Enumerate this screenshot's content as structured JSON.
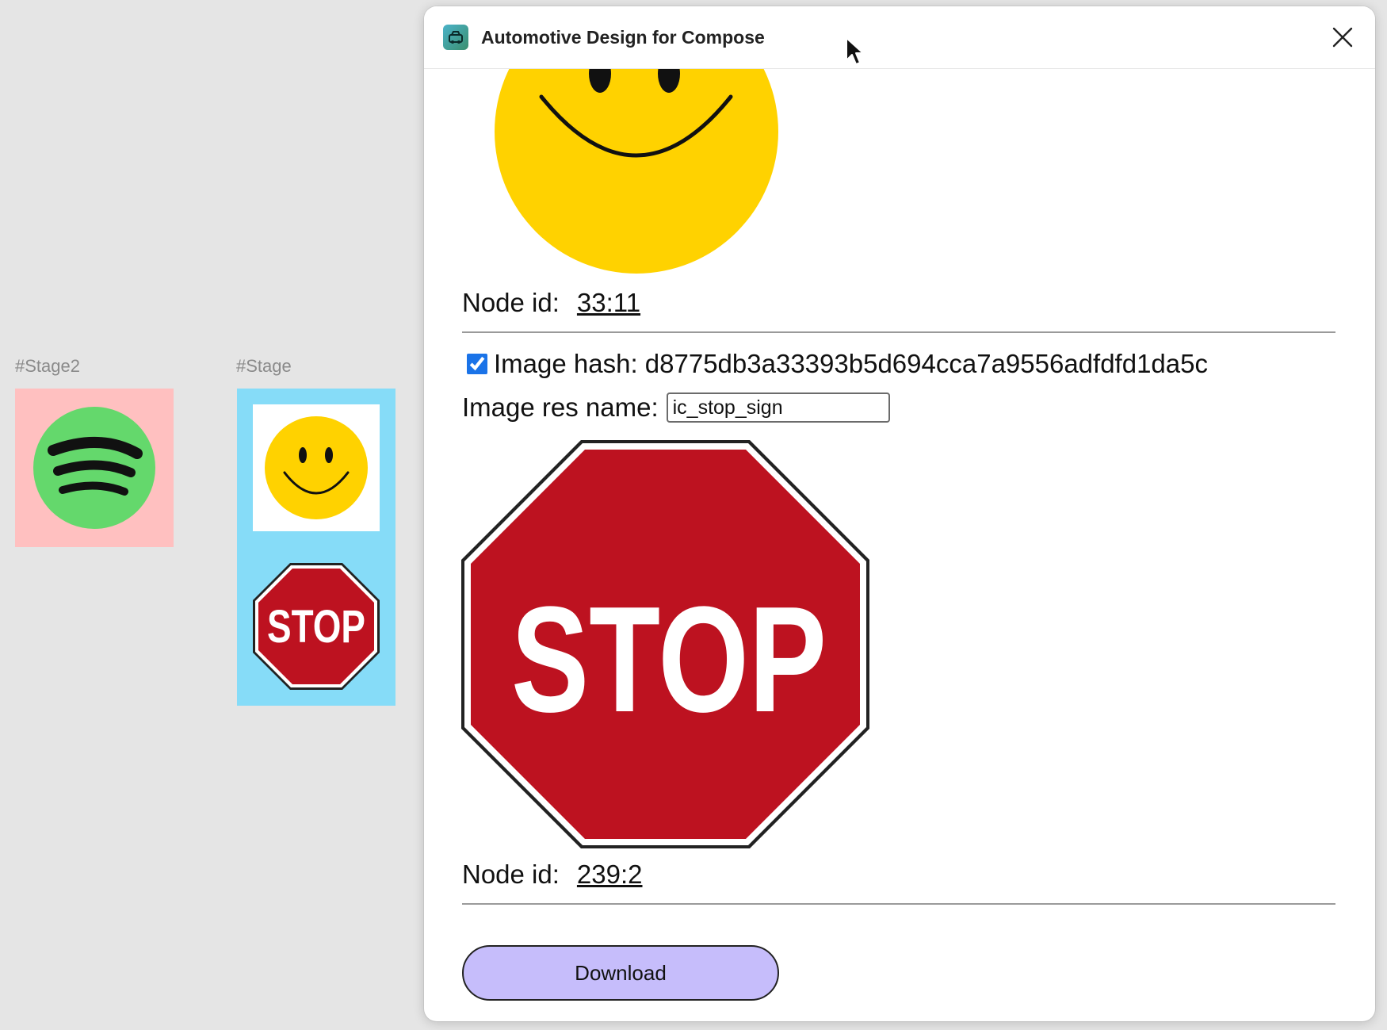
{
  "canvas": {
    "frames": [
      {
        "label": "#Stage2",
        "contents": [
          "spotify-logo"
        ]
      },
      {
        "label": "#Stage",
        "contents": [
          "smiley-face",
          "stop-sign"
        ]
      }
    ]
  },
  "plugin": {
    "title": "Automotive Design for Compose",
    "close_icon": "close-icon",
    "images": [
      {
        "node_id_label": "Node id:",
        "node_id": "33:11"
      },
      {
        "hash_label": "Image hash:",
        "hash_value": "d8775db3a33393b5d694cca7a9556adfdfd1da5c",
        "hash_checked": true,
        "res_name_label": "Image res name:",
        "res_name_value": "ic_stop_sign",
        "image_text": "STOP",
        "node_id_label": "Node id:",
        "node_id": "239:2"
      }
    ],
    "download_label": "Download"
  },
  "colors": {
    "canvas_bg": "#e5e5e5",
    "stage2_bg": "#ffc0c0",
    "stage_bg": "#86dcf8",
    "spotify_green": "#64d86c",
    "smiley_yellow": "#ffd200",
    "stop_red": "#bd1220",
    "download_bg": "#c6bdfb"
  }
}
